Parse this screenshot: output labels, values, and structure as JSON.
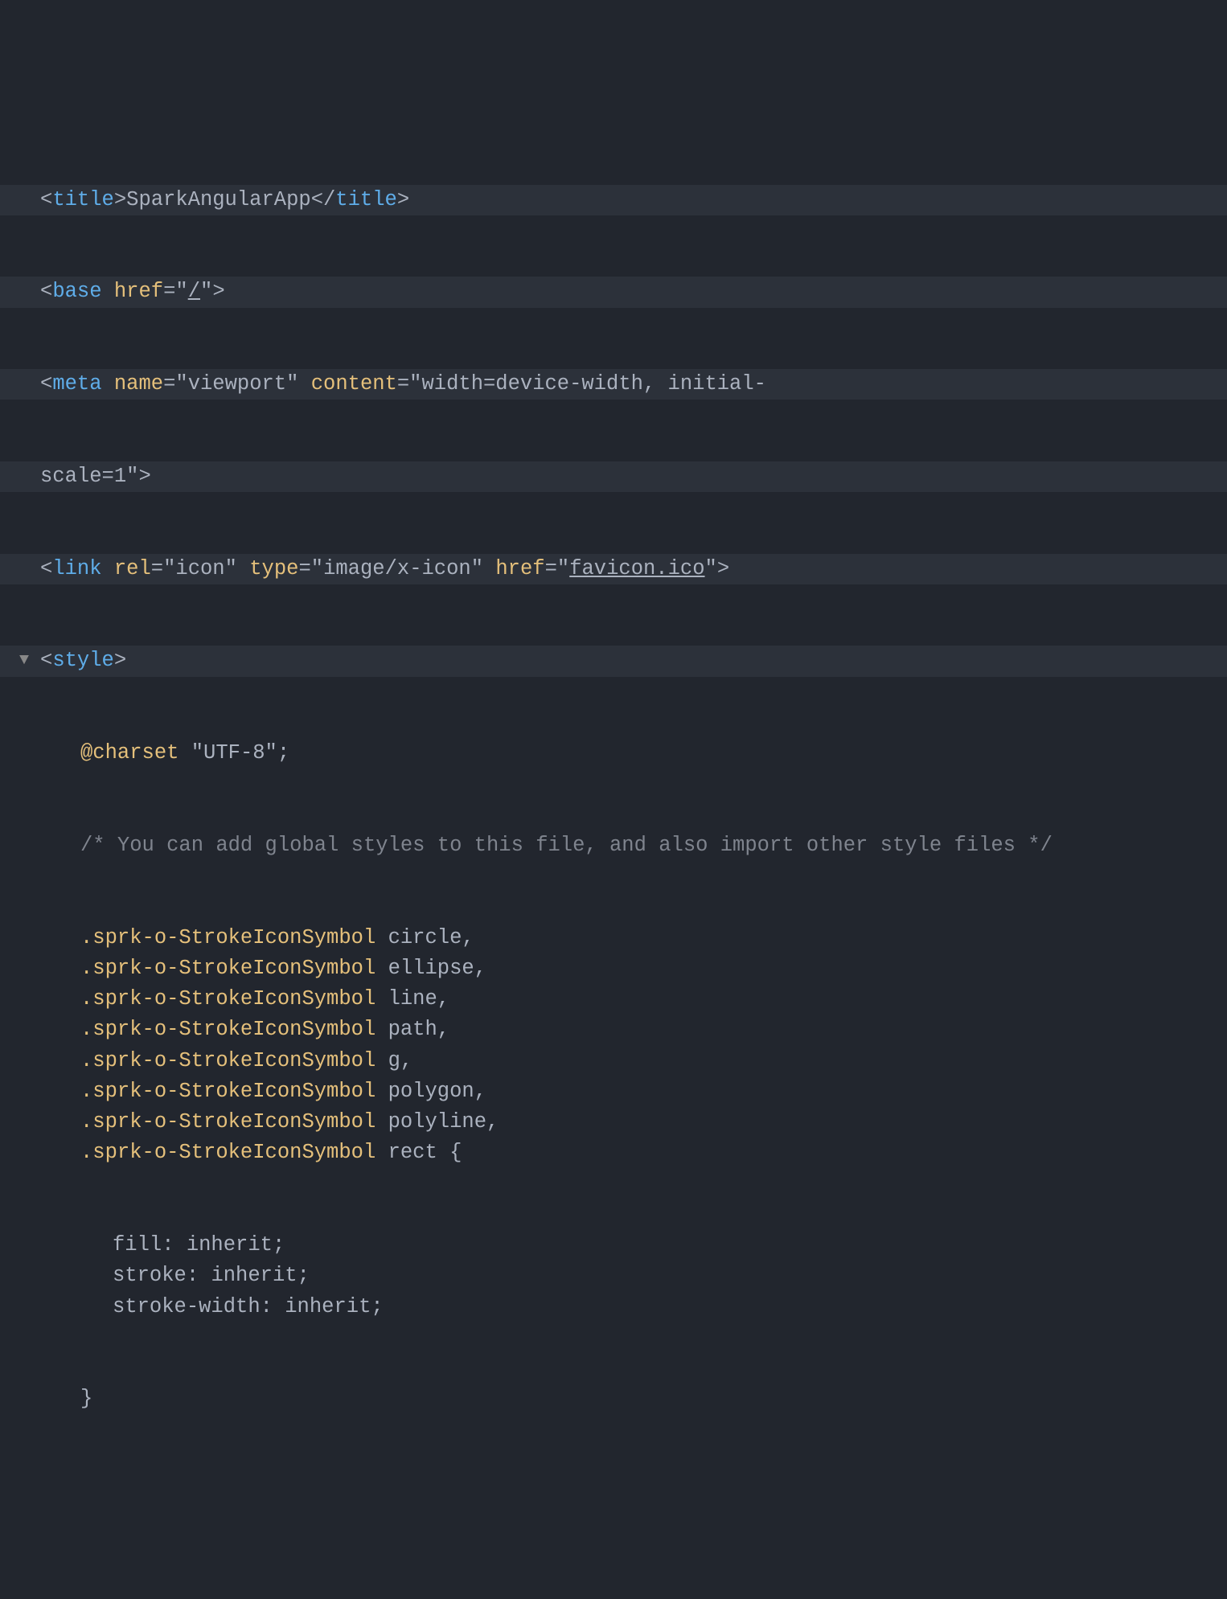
{
  "lines": {
    "l1": {
      "tag": "title",
      "text": "SparkAngularApp",
      "closeTag": "title"
    },
    "l2": {
      "tag": "base",
      "attr": "href",
      "val": "/"
    },
    "l3": {
      "tag": "meta",
      "attr1": "name",
      "val1": "viewport",
      "attr2": "content",
      "val2": "width=device-width, initial-"
    },
    "l3b": {
      "valCont": "scale=1"
    },
    "l4": {
      "tag": "link",
      "attr1": "rel",
      "val1": "icon",
      "attr2": "type",
      "val2": "image/x-icon",
      "attr3": "href",
      "val3": "favicon.ico"
    },
    "l5": {
      "tag": "style"
    },
    "css": {
      "atrule": "@charset",
      "atval": "\"UTF-8\"",
      "comment": "/* You can add global styles to this file, and also import other style files */",
      "selectors": [
        {
          "cls": ".sprk-o-StrokeIconSymbol",
          "el": "circle",
          "trail": ","
        },
        {
          "cls": ".sprk-o-StrokeIconSymbol",
          "el": "ellipse",
          "trail": ","
        },
        {
          "cls": ".sprk-o-StrokeIconSymbol",
          "el": "line",
          "trail": ","
        },
        {
          "cls": ".sprk-o-StrokeIconSymbol",
          "el": "path",
          "trail": ","
        },
        {
          "cls": ".sprk-o-StrokeIconSymbol",
          "el": "g",
          "trail": ","
        },
        {
          "cls": ".sprk-o-StrokeIconSymbol",
          "el": "polygon",
          "trail": ","
        },
        {
          "cls": ".sprk-o-StrokeIconSymbol",
          "el": "polyline",
          "trail": ","
        },
        {
          "cls": ".sprk-o-StrokeIconSymbol",
          "el": "rect",
          "trail": " {"
        }
      ],
      "decls": [
        {
          "prop": "fill",
          "val": "inherit"
        },
        {
          "prop": "stroke",
          "val": "inherit"
        },
        {
          "prop": "stroke-width",
          "val": "inherit"
        }
      ],
      "closeBrace": "}"
    }
  }
}
